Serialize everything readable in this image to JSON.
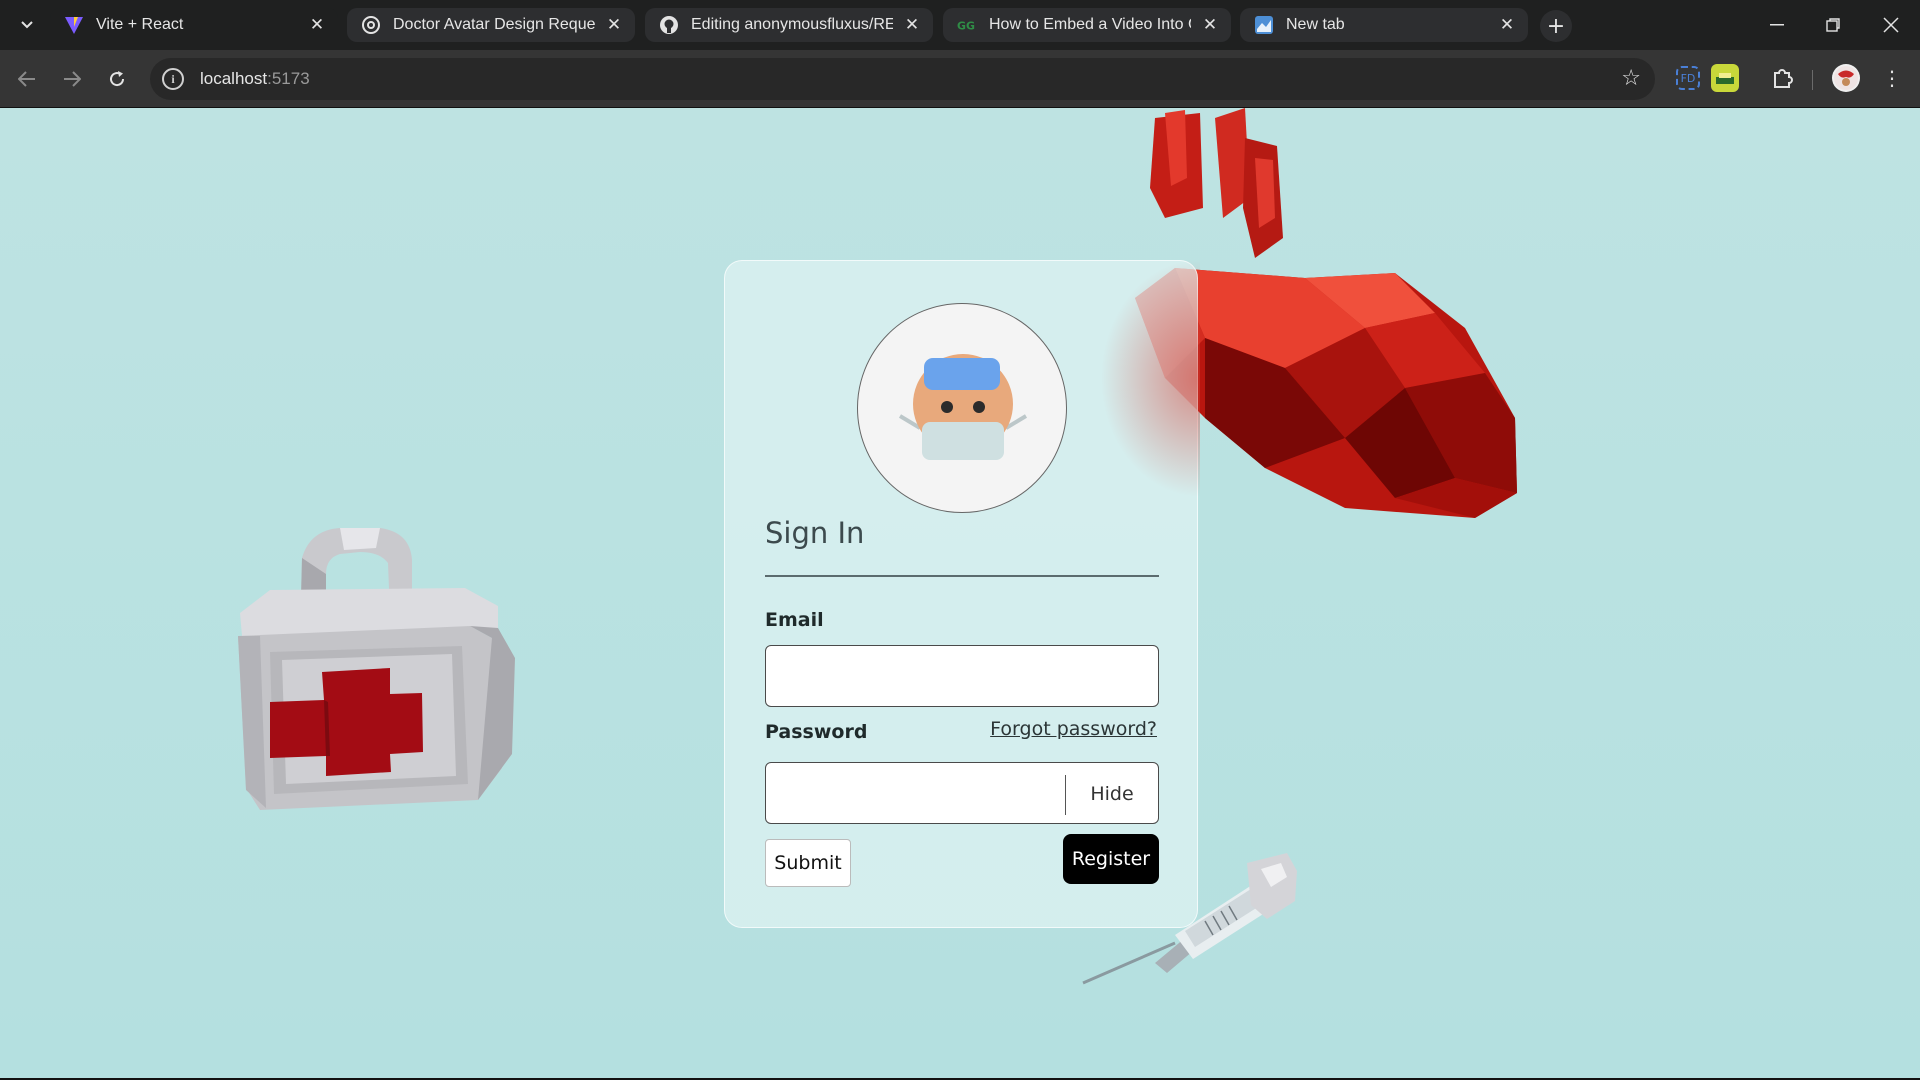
{
  "browser": {
    "tabs": [
      {
        "title": "Vite + React",
        "favicon": "vite-icon",
        "active": true
      },
      {
        "title": "Doctor Avatar Design Request",
        "favicon": "openai-icon",
        "active": false
      },
      {
        "title": "Editing anonymousfluxus/README",
        "favicon": "github-icon",
        "active": false
      },
      {
        "title": "How to Embed a Video Into GitHub",
        "favicon": "geeksforgeeks-icon",
        "active": false
      },
      {
        "title": "New tab",
        "favicon": "new-tab-icon",
        "active": false
      }
    ],
    "address": {
      "host": "localhost",
      "port": ":5173"
    }
  },
  "signin": {
    "title": "Sign In",
    "email_label": "Email",
    "email_value": "",
    "password_label": "Password",
    "password_value": "",
    "forgot_label": "Forgot password?",
    "hide_label": "Hide",
    "submit_label": "Submit",
    "register_label": "Register"
  },
  "decor": {
    "avatar": "doctor-avatar",
    "left_object": "first-aid-kit",
    "top_right_object": "low-poly-heart",
    "bottom_object": "syringe"
  },
  "colors": {
    "background": "#b8e1e1",
    "register_bg": "#000000",
    "heart_red": "#d4261c"
  }
}
